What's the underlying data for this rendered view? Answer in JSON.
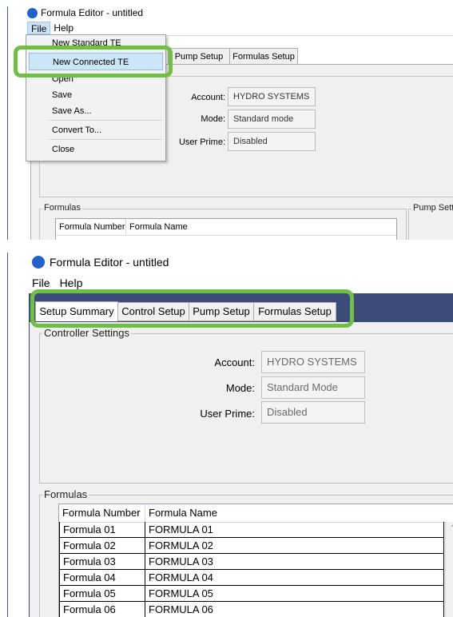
{
  "colors": {
    "accent": "#6fbf45",
    "tab_strip": "#3c4b7a",
    "selection": "#cde6f7",
    "app_icon": "#1f63c9"
  },
  "shot1": {
    "window_title": "Formula Editor - untitled",
    "menu": {
      "file": "File",
      "help": "Help"
    },
    "file_menu": {
      "items": [
        {
          "label": "New Standard TE"
        },
        {
          "label": "New Connected TE"
        },
        {
          "label": "Open"
        },
        {
          "label": "Save"
        },
        {
          "label": "Save As..."
        },
        {
          "label": "Convert To..."
        },
        {
          "label": "Close"
        }
      ],
      "selected": "New Connected TE"
    },
    "tabs": {
      "pump_setup": "Pump Setup",
      "formulas_setup": "Formulas Setup"
    },
    "fields": {
      "account": {
        "label": "Account:",
        "value": "HYDRO SYSTEMS"
      },
      "mode": {
        "label": "Mode:",
        "value": "Standard mode"
      },
      "user_prime": {
        "label": "User Prime:",
        "value": "Disabled"
      }
    },
    "formulas_legend": "Formulas",
    "pump_settings_legend": "Pump Setti",
    "columns": [
      "Formula Number",
      "Formula Name"
    ]
  },
  "shot2": {
    "window_title": "Formula Editor - untitled",
    "menu": {
      "file": "File",
      "help": "Help"
    },
    "tabs": [
      "Setup Summary",
      "Control Setup",
      "Pump Setup",
      "Formulas Setup"
    ],
    "active_tab": "Setup Summary",
    "controller_legend": "Controller Settings",
    "fields": {
      "account": {
        "label": "Account:",
        "value": "HYDRO SYSTEMS"
      },
      "mode": {
        "label": "Mode:",
        "value": "Standard Mode"
      },
      "user_prime": {
        "label": "User Prime:",
        "value": "Disabled"
      }
    },
    "formulas_legend": "Formulas",
    "columns": [
      "Formula Number",
      "Formula Name"
    ],
    "rows": [
      {
        "number": "Formula 01",
        "name": "FORMULA 01"
      },
      {
        "number": "Formula 02",
        "name": "FORMULA 02"
      },
      {
        "number": "Formula 03",
        "name": "FORMULA 03"
      },
      {
        "number": "Formula 04",
        "name": "FORMULA 04"
      },
      {
        "number": "Formula 05",
        "name": "FORMULA 05"
      },
      {
        "number": "Formula 06",
        "name": "FORMULA 06"
      }
    ]
  }
}
